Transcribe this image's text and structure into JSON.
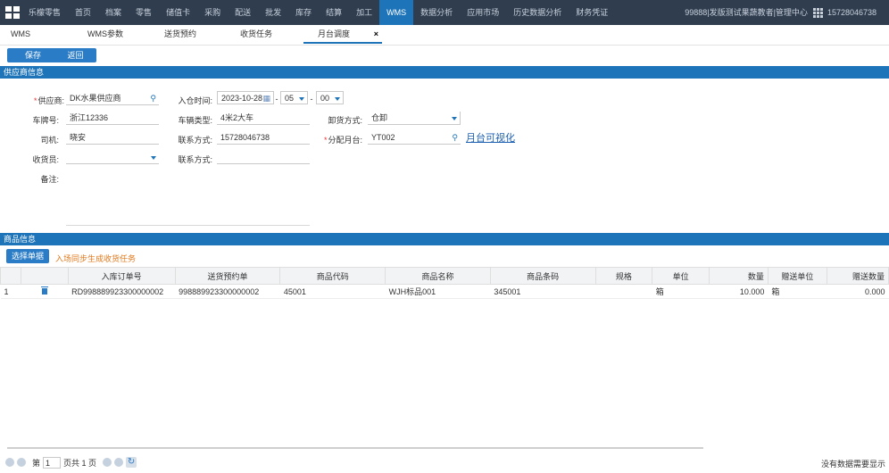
{
  "topnav": {
    "items": [
      "乐檬零售",
      "首页",
      "档案",
      "零售",
      "储值卡",
      "采购",
      "配送",
      "批发",
      "库存",
      "结算",
      "加工",
      "WMS",
      "数据分析",
      "应用市场",
      "历史数据分析",
      "财务凭证"
    ],
    "active_index": 11,
    "store": "99888|发版测试果蔬教者|管理中心",
    "phone": "15728046738"
  },
  "tabs": [
    "WMS",
    "WMS参数",
    "送货预约",
    "收货任务",
    "月台调度"
  ],
  "tab_close": "×",
  "toolbar": {
    "save": "保存",
    "back": "返回"
  },
  "supplier_section": {
    "title": "供应商信息"
  },
  "form": {
    "supplier": {
      "label": "供应商:",
      "value": "DK水果供应商"
    },
    "arrival_time": {
      "label": "入仓时间:",
      "date": "2023-10-28",
      "hour": "05",
      "minute": "00",
      "sep1": "-",
      "sep2": "-"
    },
    "plate": {
      "label": "车牌号:",
      "value": "浙江12336"
    },
    "vehicle_type": {
      "label": "车辆类型:",
      "value": "4米2大车"
    },
    "unload": {
      "label": "卸货方式:",
      "value": "仓卸"
    },
    "driver": {
      "label": "司机:",
      "value": "晓安"
    },
    "contact": {
      "label": "联系方式:",
      "value": "15728046738"
    },
    "dock": {
      "label": "分配月台:",
      "value": "YT002"
    },
    "dock_link": "月台可视化",
    "receiver": {
      "label": "收货员:",
      "value": ""
    },
    "receiver_contact": {
      "label": "联系方式:",
      "value": ""
    },
    "remark": {
      "label": "备注:",
      "value": ""
    }
  },
  "goods_section": {
    "title": "商品信息"
  },
  "goods_actions": {
    "select": "选择单据",
    "warning": "入场同步生成收货任务"
  },
  "table": {
    "columns": [
      "",
      "",
      "入库订单号",
      "送货预约单",
      "商品代码",
      "商品名称",
      "商品条码",
      "规格",
      "单位",
      "数量",
      "赠送单位",
      "赠送数量"
    ],
    "rows": [
      [
        "1",
        "",
        "RD998889923300000002",
        "998889923300000002",
        "45001",
        "WJH标品001",
        "345001",
        "",
        "箱",
        "10.000",
        "箱",
        "0.000"
      ]
    ]
  },
  "pager": {
    "first": "第",
    "page": "1",
    "of": "页共 1 页",
    "nodata": "没有数据需要显示"
  },
  "colors": {
    "topbar": "#2f3d4f",
    "accent": "#1d74b9",
    "warning": "#e07a1e"
  }
}
